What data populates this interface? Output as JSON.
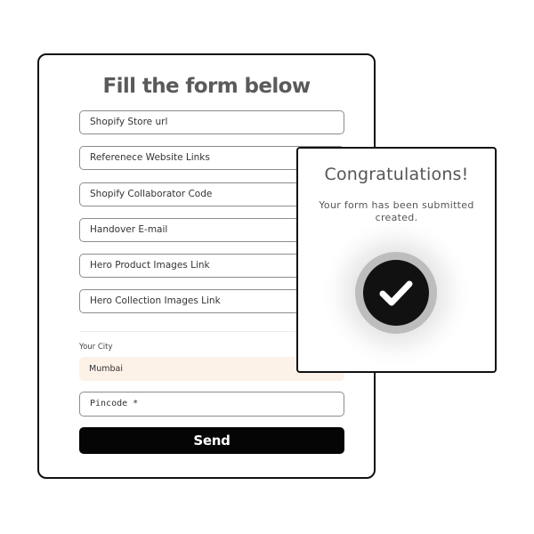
{
  "form": {
    "title": "Fill the form below",
    "fields": [
      {
        "placeholder": "Shopify Store url"
      },
      {
        "placeholder": "Referenece Website Links"
      },
      {
        "placeholder": "Shopify Collaborator Code"
      },
      {
        "placeholder": "Handover E-mail"
      },
      {
        "placeholder": "Hero Product Images Link"
      },
      {
        "placeholder": "Hero Collection Images Link"
      }
    ],
    "city": {
      "label": "Your City",
      "value": "Mumbai"
    },
    "pincode": {
      "placeholder": "Pincode *"
    },
    "send_label": "Send"
  },
  "success": {
    "title": "Congratulations!",
    "message": "Your form has been submitted created.",
    "icon": "checkmark-icon"
  },
  "colors": {
    "button_bg": "#050505",
    "city_bg": "#fdf2e8",
    "title_text": "#5a5a5a"
  }
}
